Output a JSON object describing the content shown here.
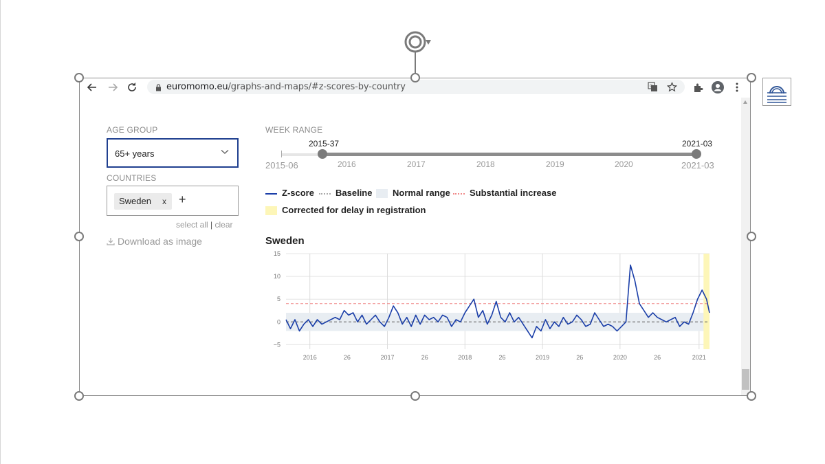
{
  "browser": {
    "url_host": "euromomo.eu",
    "url_path": "/graphs-and-maps/#z-scores-by-country"
  },
  "filters": {
    "age_group_label": "AGE GROUP",
    "age_group_value": "65+ years",
    "countries_label": "COUNTRIES",
    "country_chip": "Sweden",
    "chip_remove": "x",
    "add_country": "+",
    "select_all": "select all",
    "separator": "|",
    "clear": "clear",
    "download": "Download as image"
  },
  "week_range": {
    "label": "WEEK RANGE",
    "min_label": "2015-06",
    "max_label": "2021-03",
    "start": "2015-37",
    "end": "2021-03",
    "year_labels": [
      "2016",
      "2017",
      "2018",
      "2019",
      "2020"
    ]
  },
  "legend": {
    "zscore": "Z-score",
    "baseline": "Baseline",
    "normal_range": "Normal range",
    "substantial_increase": "Substantial increase",
    "corrected": "Corrected for delay in registration"
  },
  "colors": {
    "zscore_line": "#1a3ea8",
    "normal_range": "#e8edf2",
    "substantial": "#f08a8a",
    "baseline": "#555555",
    "corrected": "#fdf6b8",
    "accent": "#1f3f8f"
  },
  "chart_data": {
    "type": "line",
    "title": "Sweden",
    "yticks": [
      15,
      10,
      5,
      0,
      -5
    ],
    "ylim": [
      -6,
      15
    ],
    "xlim": [
      0,
      284
    ],
    "xticks": [
      {
        "label": "2016",
        "x": 16
      },
      {
        "label": "26",
        "x": 41
      },
      {
        "label": "2017",
        "x": 68
      },
      {
        "label": "26",
        "x": 93
      },
      {
        "label": "2018",
        "x": 120
      },
      {
        "label": "26",
        "x": 145
      },
      {
        "label": "2019",
        "x": 172
      },
      {
        "label": "26",
        "x": 197
      },
      {
        "label": "2020",
        "x": 224
      },
      {
        "label": "26",
        "x": 249
      },
      {
        "label": "2021",
        "x": 277
      }
    ],
    "baseline": 0,
    "normal_range": [
      -2,
      2
    ],
    "substantial_increase": 4,
    "corrected_from_x": 280,
    "series": [
      {
        "name": "Z-score",
        "x": [
          0,
          3,
          6,
          9,
          12,
          15,
          18,
          21,
          24,
          27,
          30,
          33,
          36,
          39,
          42,
          45,
          48,
          51,
          54,
          57,
          60,
          63,
          66,
          69,
          72,
          75,
          78,
          81,
          84,
          87,
          90,
          93,
          96,
          99,
          102,
          105,
          108,
          111,
          114,
          117,
          120,
          123,
          126,
          129,
          132,
          135,
          138,
          141,
          144,
          147,
          150,
          153,
          156,
          159,
          162,
          165,
          168,
          171,
          174,
          177,
          180,
          183,
          186,
          189,
          192,
          195,
          198,
          201,
          204,
          207,
          210,
          213,
          216,
          219,
          222,
          225,
          228,
          231,
          234,
          237,
          240,
          243,
          246,
          249,
          252,
          255,
          258,
          261,
          264,
          267,
          270,
          273,
          276,
          279,
          282,
          284
        ],
        "y": [
          0.5,
          -1.5,
          0.5,
          -2,
          -0.5,
          0.5,
          -1,
          0.5,
          -0.5,
          0,
          0.5,
          1,
          0.5,
          2.5,
          1.5,
          2,
          0,
          1.5,
          -0.5,
          0.5,
          1.5,
          0,
          -1,
          1,
          3.5,
          2,
          -0.5,
          1,
          -1,
          1.5,
          -0.5,
          1.5,
          0.5,
          1,
          0,
          1.5,
          1,
          -1,
          0.5,
          0,
          2,
          3.5,
          5,
          1,
          2.5,
          -0.5,
          1.5,
          4.5,
          1,
          0,
          2,
          0,
          1,
          -0.5,
          -2,
          -3.5,
          -1,
          -2,
          0.5,
          -1.5,
          0,
          -1,
          1,
          -0.5,
          0,
          1.5,
          0.5,
          -1,
          -0.5,
          2,
          0.5,
          -1,
          -0.5,
          -1,
          -2,
          -1,
          0,
          12.5,
          9,
          4,
          2.5,
          1,
          2,
          1,
          0.5,
          0,
          0.5,
          1,
          -1,
          0,
          -0.5,
          2,
          5,
          7,
          5,
          2
        ]
      }
    ]
  }
}
